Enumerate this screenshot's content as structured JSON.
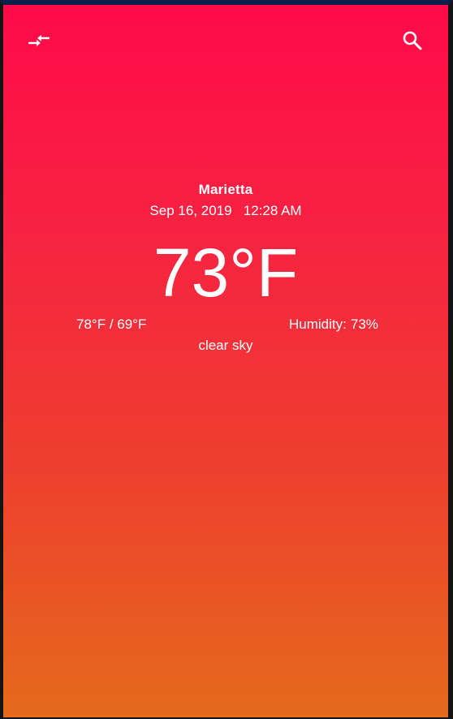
{
  "weather": {
    "city": "Marietta",
    "datetime": "Sep 16, 2019   12:28 AM",
    "temperature": "73°F",
    "high_low": "78°F / 69°F",
    "humidity_label": "Humidity:",
    "humidity_value": "73%",
    "description": "clear sky"
  },
  "colors": {
    "gradient_top": "#ff0a4a",
    "gradient_bottom": "#e56a1c",
    "text": "#ffffff",
    "status_bar": "#0b1f4a"
  },
  "icons": {
    "left": "swap-units-icon",
    "right": "search-icon"
  }
}
